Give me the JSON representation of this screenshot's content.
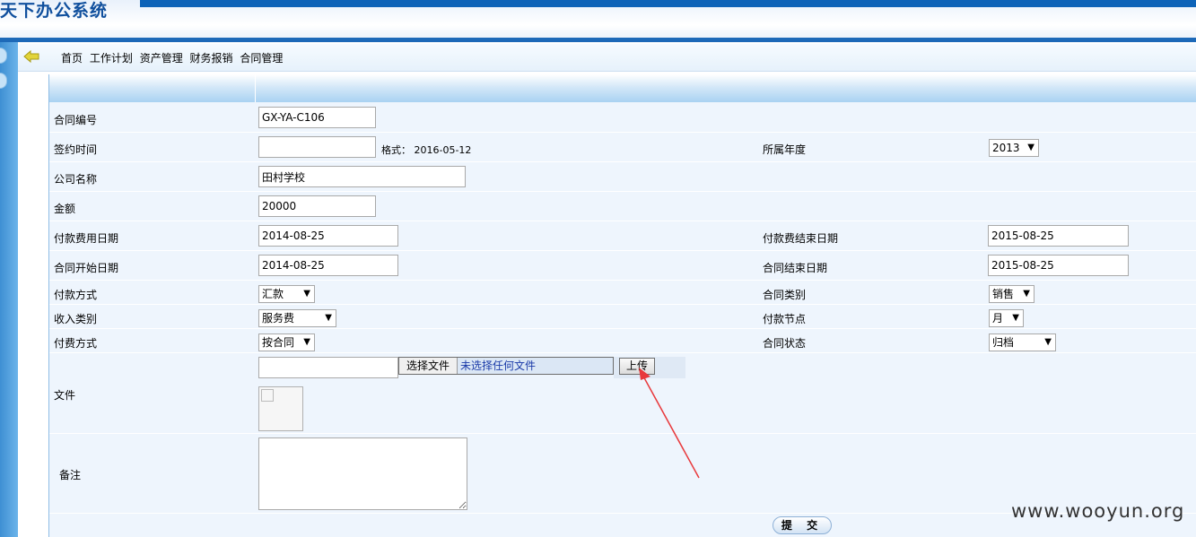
{
  "header": {
    "title": "天下办公系统"
  },
  "breadcrumb": [
    "首页",
    "工作计划",
    "资产管理",
    "财务报销",
    "合同管理"
  ],
  "form": {
    "contract_no": {
      "label": "合同编号",
      "value": "GX-YA-C106"
    },
    "sign_time": {
      "label": "签约时间",
      "value": "",
      "hint": "格式： 2016-05-12"
    },
    "year": {
      "label": "所属年度",
      "value": "2013"
    },
    "company": {
      "label": "公司名称",
      "value": "田村学校"
    },
    "amount": {
      "label": "金额",
      "value": "20000"
    },
    "pay_start": {
      "label": "付款费用日期",
      "value": "2014-08-25"
    },
    "pay_end": {
      "label": "付款费结束日期",
      "value": "2015-08-25"
    },
    "contract_start": {
      "label": "合同开始日期",
      "value": "2014-08-25"
    },
    "contract_end": {
      "label": "合同结束日期",
      "value": "2015-08-25"
    },
    "pay_method": {
      "label": "付款方式",
      "value": "汇款"
    },
    "contract_type": {
      "label": "合同类别",
      "value": "销售"
    },
    "income_type": {
      "label": "收入类别",
      "value": "服务费"
    },
    "pay_node": {
      "label": "付款节点",
      "value": "月"
    },
    "fee_method": {
      "label": "付费方式",
      "value": "按合同"
    },
    "contract_status": {
      "label": "合同状态",
      "value": "归档"
    },
    "file": {
      "label": "文件",
      "choose_label": "选择文件",
      "no_file": "未选择任何文件",
      "upload_label": "上传"
    },
    "remark": {
      "label": "备注"
    },
    "submit_label": "提 交"
  },
  "watermark": "www.wooyun.org",
  "colors": {
    "header_blue": "#0d63b8",
    "frame_bg": "#eef5fd",
    "arrow": "#e8393c"
  }
}
